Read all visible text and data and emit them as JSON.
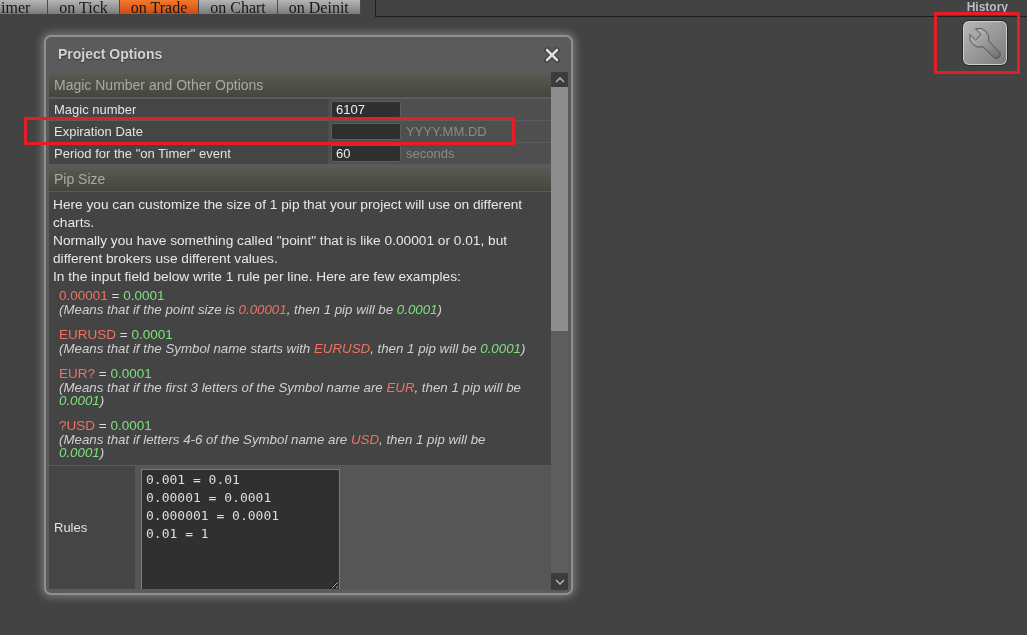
{
  "top_tabs": [
    {
      "label": "imer",
      "selected": false
    },
    {
      "label": "on Tick",
      "selected": false
    },
    {
      "label": "on Trade",
      "selected": true
    },
    {
      "label": "on Chart",
      "selected": false
    },
    {
      "label": "on Deinit",
      "selected": false
    }
  ],
  "history_label": "History",
  "tool_button": {
    "highlighted": true
  },
  "dialog": {
    "title": "Project Options",
    "options_section": {
      "title": "Magic Number and Other Options",
      "rows": [
        {
          "label": "Magic number",
          "value": "6107",
          "highlighted": false
        },
        {
          "label": "Expiration Date",
          "hint": "YYYY.MM.DD",
          "highlighted": true
        },
        {
          "label": "Period for the \"on Timer\" event",
          "value": "60",
          "hint": "seconds",
          "highlighted": false
        }
      ]
    },
    "pip_section": {
      "title": "Pip Size",
      "description": [
        "Here you can customize the size of 1 pip that your project will use on different charts.",
        "Normally you have something called \"point\" that is like 0.00001 or 0.01, but different brokers use different values.",
        "In the input field below write 1 rule per line. Here are few examples:"
      ],
      "examples": [
        {
          "rule": [
            {
              "kind": "pattern",
              "text": "0.00001"
            },
            {
              "kind": "plain",
              "text": " = "
            },
            {
              "kind": "value",
              "text": "0.0001"
            }
          ],
          "explanation": [
            {
              "kind": "plain",
              "text": "(Means that if the point size is "
            },
            {
              "kind": "pattern",
              "text": "0.00001"
            },
            {
              "kind": "plain",
              "text": ", then 1 pip will be "
            },
            {
              "kind": "value",
              "text": "0.0001"
            },
            {
              "kind": "plain",
              "text": ")"
            }
          ]
        },
        {
          "rule": [
            {
              "kind": "pattern",
              "text": "EURUSD"
            },
            {
              "kind": "plain",
              "text": " = "
            },
            {
              "kind": "value",
              "text": "0.0001"
            }
          ],
          "explanation": [
            {
              "kind": "plain",
              "text": "(Means that if the Symbol name starts with "
            },
            {
              "kind": "pattern",
              "text": "EURUSD"
            },
            {
              "kind": "plain",
              "text": ", then 1 pip will be "
            },
            {
              "kind": "value",
              "text": "0.0001"
            },
            {
              "kind": "plain",
              "text": ")"
            }
          ]
        },
        {
          "rule": [
            {
              "kind": "pattern",
              "text": "EUR?"
            },
            {
              "kind": "plain",
              "text": " = "
            },
            {
              "kind": "value",
              "text": "0.0001"
            }
          ],
          "explanation": [
            {
              "kind": "plain",
              "text": "(Means that if the first 3 letters of the Symbol name are "
            },
            {
              "kind": "pattern",
              "text": "EUR"
            },
            {
              "kind": "plain",
              "text": ", then 1 pip will be "
            },
            {
              "kind": "value",
              "text": "0.0001"
            },
            {
              "kind": "plain",
              "text": ")"
            }
          ]
        },
        {
          "rule": [
            {
              "kind": "pattern",
              "text": "?USD"
            },
            {
              "kind": "plain",
              "text": " = "
            },
            {
              "kind": "value",
              "text": "0.0001"
            }
          ],
          "explanation": [
            {
              "kind": "plain",
              "text": "(Means that if letters 4-6 of the Symbol name are "
            },
            {
              "kind": "pattern",
              "text": "USD"
            },
            {
              "kind": "plain",
              "text": ", then 1 pip will be "
            },
            {
              "kind": "value",
              "text": "0.0001"
            },
            {
              "kind": "plain",
              "text": ")"
            }
          ]
        }
      ],
      "rules": {
        "label": "Rules",
        "lines": [
          "0.001 = 0.01",
          "0.00001 = 0.0001",
          "0.000001 = 0.0001",
          "0.01 = 1"
        ]
      }
    }
  }
}
